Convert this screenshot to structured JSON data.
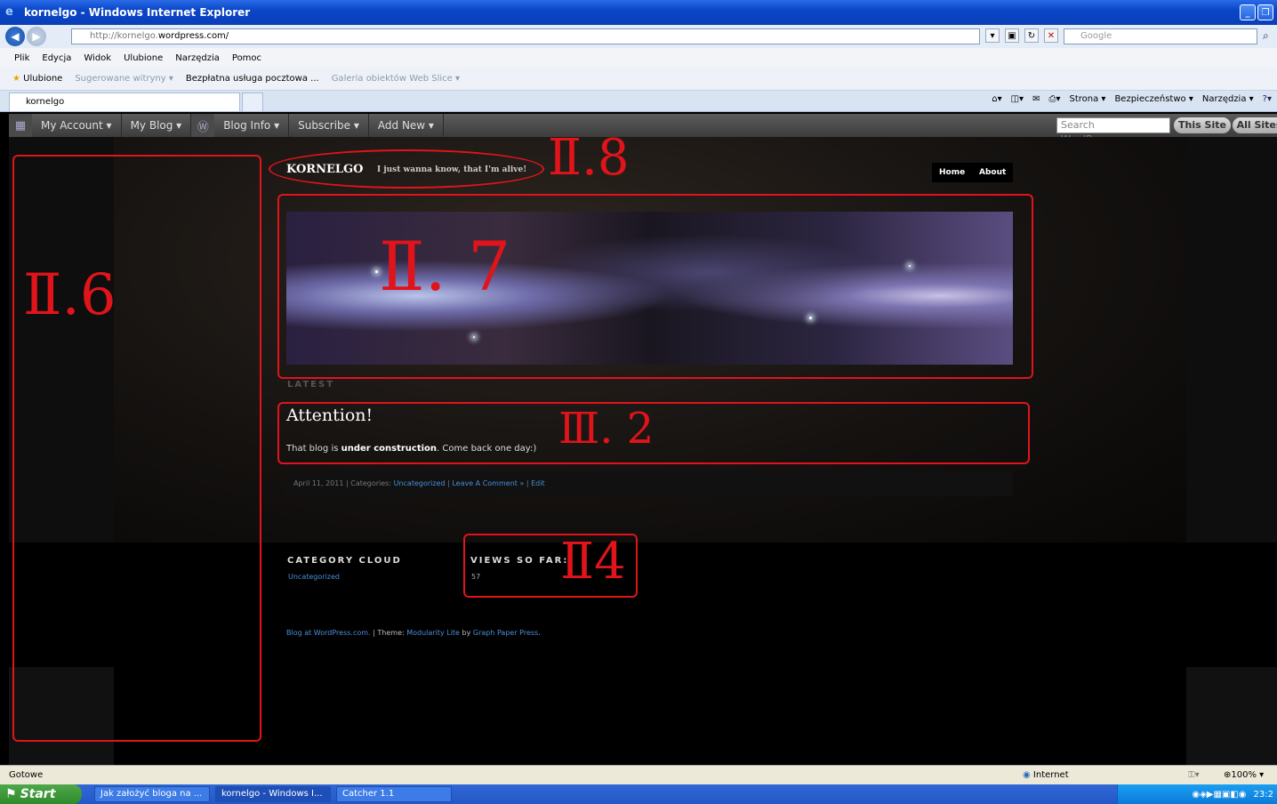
{
  "window": {
    "title": "kornelgo - Windows Internet Explorer"
  },
  "address": {
    "url_prefix": "http://kornelgo.",
    "url_domain": "wordpress.com/",
    "search_placeholder": "Google"
  },
  "menu": [
    "Plik",
    "Edycja",
    "Widok",
    "Ulubione",
    "Narzędzia",
    "Pomoc"
  ],
  "favorites": {
    "label": "Ulubione",
    "suggested": "Sugerowane witryny ▾",
    "mail": "Bezpłatna usługa pocztowa ...",
    "gallery": "Galeria obiektów Web Slice ▾"
  },
  "tab": {
    "title": "kornelgo"
  },
  "commandbar": {
    "page": "Strona ▾",
    "security": "Bezpieczeństwo ▾",
    "tools": "Narzędzia ▾"
  },
  "wpbar": {
    "my_account": "My Account ▾",
    "my_blog": "My Blog ▾",
    "blog_info": "Blog Info ▾",
    "subscribe": "Subscribe ▾",
    "add_new": "Add New ▾",
    "search_placeholder": "Search WordPress.com",
    "this_site": "This Site",
    "all_sites": "All Sites"
  },
  "blog": {
    "name": "KORNELGO",
    "tagline": "I just wanna know, that I'm alive!",
    "nav": [
      "Home",
      "About"
    ],
    "latest_label": "LATEST",
    "post": {
      "title": "Attention!",
      "body_pre": "That blog is ",
      "body_bold": "under construction",
      "body_post": ". Come back one day:)",
      "meta_date": "April 11, 2011 | Categories: ",
      "meta_category": "Uncategorized",
      "meta_sep": " | ",
      "meta_comment": "Leave A Comment »",
      "meta_sep2": " | ",
      "meta_edit": "Edit"
    },
    "widgets": {
      "category_title": "CATEGORY CLOUD",
      "category_link": "Uncategorized",
      "views_title": "VIEWS SO FAR:",
      "views_value": "57"
    },
    "footer": {
      "blog_at": "Blog at WordPress.com.",
      "theme_label": " | Theme: ",
      "theme": "Modularity Lite",
      "by": " by ",
      "author": "Graph Paper Press",
      "end": "."
    }
  },
  "annotations": {
    "a_left": "Ⅱ.6",
    "a_banner": "Ⅱ. 7",
    "a_title": "Ⅱ.8",
    "a_post": "Ⅲ. 2",
    "a_views": "Ⅱ4"
  },
  "status": {
    "left": "Gotowe",
    "zone": "Internet",
    "zoom": "100%"
  },
  "taskbar": {
    "start": "Start",
    "tasks": [
      "Jak założyć bloga na ...",
      "kornelgo - Windows I...",
      "Catcher 1.1"
    ],
    "clock": "23:2"
  },
  "colors": {
    "annotation_red": "#e0141a",
    "link_blue": "#4a8fd8",
    "xp_blue": "#0a46c8"
  }
}
